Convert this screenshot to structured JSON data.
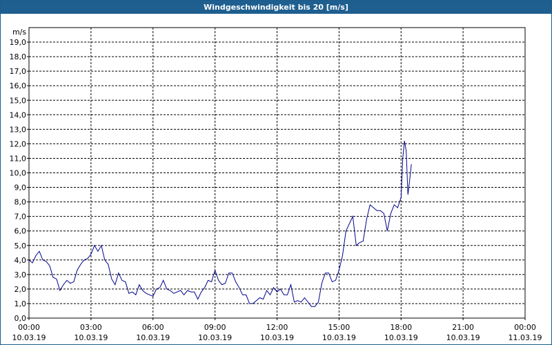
{
  "window": {
    "title": "Windgeschwindigkeit bis 20 [m/s]"
  },
  "chart_data": {
    "type": "line",
    "title": "Windgeschwindigkeit bis 20 [m/s]",
    "ylabel": "m/s",
    "ylim": [
      0,
      20
    ],
    "xlim": [
      "2019-03-10T00:00",
      "2019-03-11T00:00"
    ],
    "grid": true,
    "line_color": "#00008b",
    "y_ticks": [
      "0,0",
      "1,0",
      "2,0",
      "3,0",
      "4,0",
      "5,0",
      "6,0",
      "7,0",
      "8,0",
      "9,0",
      "10,0",
      "11,0",
      "12,0",
      "13,0",
      "14,0",
      "15,0",
      "16,0",
      "17,0",
      "18,0",
      "19,0"
    ],
    "x_ticks": [
      {
        "time": "00:00",
        "date": "10.03.19"
      },
      {
        "time": "03:00",
        "date": "10.03.19"
      },
      {
        "time": "06:00",
        "date": "10.03.19"
      },
      {
        "time": "09:00",
        "date": "10.03.19"
      },
      {
        "time": "12:00",
        "date": "10.03.19"
      },
      {
        "time": "15:00",
        "date": "10.03.19"
      },
      {
        "time": "18:00",
        "date": "10.03.19"
      },
      {
        "time": "21:00",
        "date": "10.03.19"
      },
      {
        "time": "00:00",
        "date": "11.03.19"
      }
    ],
    "series": [
      {
        "points": [
          [
            "2019-03-10T00:00",
            4.0
          ],
          [
            "2019-03-10T00:10",
            3.8
          ],
          [
            "2019-03-10T00:20",
            4.3
          ],
          [
            "2019-03-10T00:30",
            4.6
          ],
          [
            "2019-03-10T00:40",
            4.0
          ],
          [
            "2019-03-10T00:50",
            3.9
          ],
          [
            "2019-03-10T01:00",
            3.6
          ],
          [
            "2019-03-10T01:10",
            2.8
          ],
          [
            "2019-03-10T01:20",
            2.7
          ],
          [
            "2019-03-10T01:30",
            1.9
          ],
          [
            "2019-03-10T01:40",
            2.3
          ],
          [
            "2019-03-10T01:50",
            2.6
          ],
          [
            "2019-03-10T02:00",
            2.4
          ],
          [
            "2019-03-10T02:10",
            2.5
          ],
          [
            "2019-03-10T02:20",
            3.3
          ],
          [
            "2019-03-10T02:30",
            3.7
          ],
          [
            "2019-03-10T02:40",
            4.0
          ],
          [
            "2019-03-10T02:50",
            4.1
          ],
          [
            "2019-03-10T03:00",
            4.4
          ],
          [
            "2019-03-10T03:10",
            5.0
          ],
          [
            "2019-03-10T03:20",
            4.6
          ],
          [
            "2019-03-10T03:30",
            5.0
          ],
          [
            "2019-03-10T03:40",
            4.0
          ],
          [
            "2019-03-10T03:50",
            3.7
          ],
          [
            "2019-03-10T04:00",
            2.7
          ],
          [
            "2019-03-10T04:10",
            2.3
          ],
          [
            "2019-03-10T04:20",
            3.1
          ],
          [
            "2019-03-10T04:30",
            2.6
          ],
          [
            "2019-03-10T04:40",
            2.5
          ],
          [
            "2019-03-10T04:50",
            1.7
          ],
          [
            "2019-03-10T05:00",
            1.8
          ],
          [
            "2019-03-10T05:10",
            1.6
          ],
          [
            "2019-03-10T05:20",
            2.3
          ],
          [
            "2019-03-10T05:30",
            1.9
          ],
          [
            "2019-03-10T05:40",
            1.7
          ],
          [
            "2019-03-10T05:50",
            1.6
          ],
          [
            "2019-03-10T06:00",
            1.5
          ],
          [
            "2019-03-10T06:10",
            2.0
          ],
          [
            "2019-03-10T06:20",
            2.1
          ],
          [
            "2019-03-10T06:30",
            2.6
          ],
          [
            "2019-03-10T06:40",
            2.0
          ],
          [
            "2019-03-10T06:50",
            1.9
          ],
          [
            "2019-03-10T07:00",
            1.7
          ],
          [
            "2019-03-10T07:10",
            1.8
          ],
          [
            "2019-03-10T07:20",
            1.9
          ],
          [
            "2019-03-10T07:30",
            1.6
          ],
          [
            "2019-03-10T07:40",
            1.9
          ],
          [
            "2019-03-10T07:50",
            1.8
          ],
          [
            "2019-03-10T08:00",
            1.8
          ],
          [
            "2019-03-10T08:10",
            1.3
          ],
          [
            "2019-03-10T08:20",
            1.8
          ],
          [
            "2019-03-10T08:30",
            2.1
          ],
          [
            "2019-03-10T08:40",
            2.6
          ],
          [
            "2019-03-10T08:50",
            2.5
          ],
          [
            "2019-03-10T09:00",
            3.3
          ],
          [
            "2019-03-10T09:10",
            2.6
          ],
          [
            "2019-03-10T09:20",
            2.3
          ],
          [
            "2019-03-10T09:30",
            2.4
          ],
          [
            "2019-03-10T09:40",
            3.1
          ],
          [
            "2019-03-10T09:50",
            3.1
          ],
          [
            "2019-03-10T10:00",
            2.5
          ],
          [
            "2019-03-10T10:10",
            2.1
          ],
          [
            "2019-03-10T10:20",
            1.6
          ],
          [
            "2019-03-10T10:30",
            1.6
          ],
          [
            "2019-03-10T10:40",
            1.0
          ],
          [
            "2019-03-10T10:50",
            1.0
          ],
          [
            "2019-03-10T11:00",
            1.2
          ],
          [
            "2019-03-10T11:10",
            1.4
          ],
          [
            "2019-03-10T11:20",
            1.3
          ],
          [
            "2019-03-10T11:30",
            1.9
          ],
          [
            "2019-03-10T11:40",
            1.6
          ],
          [
            "2019-03-10T11:50",
            2.1
          ],
          [
            "2019-03-10T12:00",
            1.8
          ],
          [
            "2019-03-10T12:10",
            2.0
          ],
          [
            "2019-03-10T12:20",
            1.6
          ],
          [
            "2019-03-10T12:30",
            1.6
          ],
          [
            "2019-03-10T12:40",
            2.3
          ],
          [
            "2019-03-10T12:50",
            1.1
          ],
          [
            "2019-03-10T13:00",
            1.2
          ],
          [
            "2019-03-10T13:10",
            1.1
          ],
          [
            "2019-03-10T13:20",
            1.4
          ],
          [
            "2019-03-10T13:30",
            1.1
          ],
          [
            "2019-03-10T13:40",
            0.8
          ],
          [
            "2019-03-10T13:50",
            0.8
          ],
          [
            "2019-03-10T14:00",
            1.1
          ],
          [
            "2019-03-10T14:10",
            2.4
          ],
          [
            "2019-03-10T14:20",
            3.1
          ],
          [
            "2019-03-10T14:30",
            3.1
          ],
          [
            "2019-03-10T14:40",
            2.5
          ],
          [
            "2019-03-10T14:50",
            2.6
          ],
          [
            "2019-03-10T15:00",
            3.3
          ],
          [
            "2019-03-10T15:10",
            4.3
          ],
          [
            "2019-03-10T15:20",
            6.0
          ],
          [
            "2019-03-10T15:30",
            6.5
          ],
          [
            "2019-03-10T15:40",
            7.0
          ],
          [
            "2019-03-10T15:50",
            5.0
          ],
          [
            "2019-03-10T16:00",
            5.2
          ],
          [
            "2019-03-10T16:10",
            5.3
          ],
          [
            "2019-03-10T16:20",
            6.8
          ],
          [
            "2019-03-10T16:30",
            7.8
          ],
          [
            "2019-03-10T16:40",
            7.6
          ],
          [
            "2019-03-10T16:50",
            7.4
          ],
          [
            "2019-03-10T17:00",
            7.4
          ],
          [
            "2019-03-10T17:10",
            7.2
          ],
          [
            "2019-03-10T17:20",
            6.0
          ],
          [
            "2019-03-10T17:30",
            7.2
          ],
          [
            "2019-03-10T17:40",
            7.8
          ],
          [
            "2019-03-10T17:50",
            7.6
          ],
          [
            "2019-03-10T18:00",
            8.3
          ],
          [
            "2019-03-10T18:05",
            11.0
          ],
          [
            "2019-03-10T18:10",
            12.2
          ],
          [
            "2019-03-10T18:15",
            11.5
          ],
          [
            "2019-03-10T18:20",
            8.5
          ],
          [
            "2019-03-10T18:25",
            9.5
          ],
          [
            "2019-03-10T18:30",
            10.6
          ]
        ]
      }
    ]
  }
}
